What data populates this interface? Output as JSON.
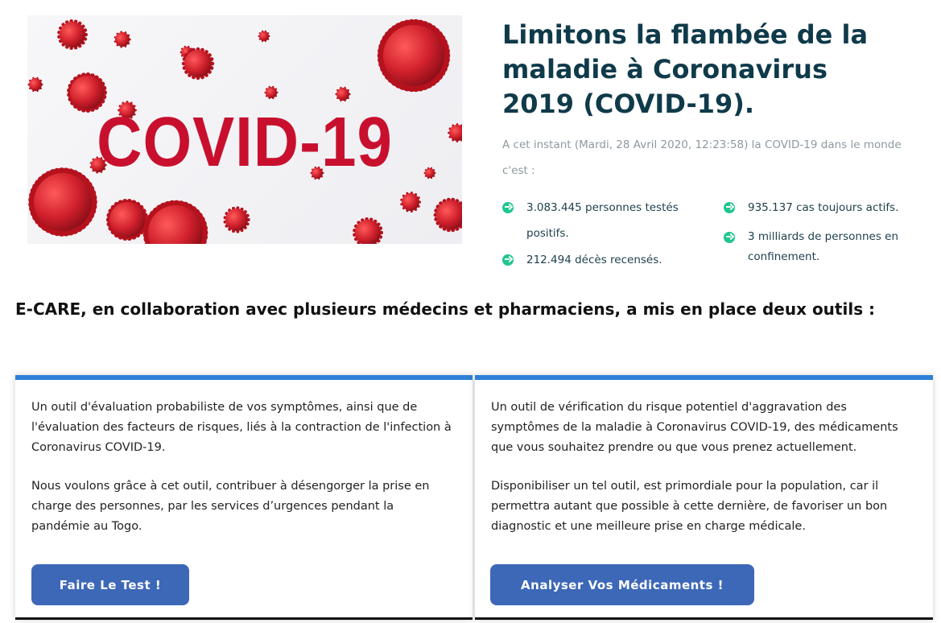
{
  "hero": {
    "image_text": "COVID-19",
    "colors": {
      "virus": "#d0202c",
      "text": "#c8102e"
    }
  },
  "headline": "Limitons la flambée de la maladie à Coronavirus 2019 (COVID-19).",
  "intro": "A cet instant (Mardi, 28 Avril 2020, 12:23:58) la COVID-19 dans le monde c'est :",
  "stats": [
    "3.083.445 personnes testés positifs.",
    "212.494 décès recensés.",
    "935.137 cas toujours actifs.",
    "3 milliards de personnes en confinement."
  ],
  "section_title": "E-CARE, en collaboration avec plusieurs médecins et pharmaciens, a mis en place deux outils :",
  "cards": [
    {
      "p1": "Un outil d'évaluation probabiliste de vos symptômes, ainsi que de l'évaluation des facteurs de risques, liés à la contraction de l'infection à Coronavirus COVID-19.",
      "p2": "Nous voulons grâce à cet outil, contribuer à désengorger la prise en charge des personnes, par les services d’urgences pendant la pandémie au Togo.",
      "button": "Faire Le Test !"
    },
    {
      "p1": "Un outil de vérification du risque potentiel d'aggravation des symptômes de la maladie à Coronavirus COVID-19, des médicaments que vous souhaitez prendre ou que vous prenez actuellement.",
      "p2": "Disponibiliser un tel outil, est primordiale pour la population, car il permettra autant que possible à cette dernière, de favoriser un bon diagnostic et une meilleure prise en charge médicale.",
      "button": "Analyser Vos Médicaments !"
    }
  ],
  "colors": {
    "accent": "#2e7fd6",
    "button": "#3d68b8",
    "check": "#1ec68e",
    "headline": "#0f3a4a"
  }
}
